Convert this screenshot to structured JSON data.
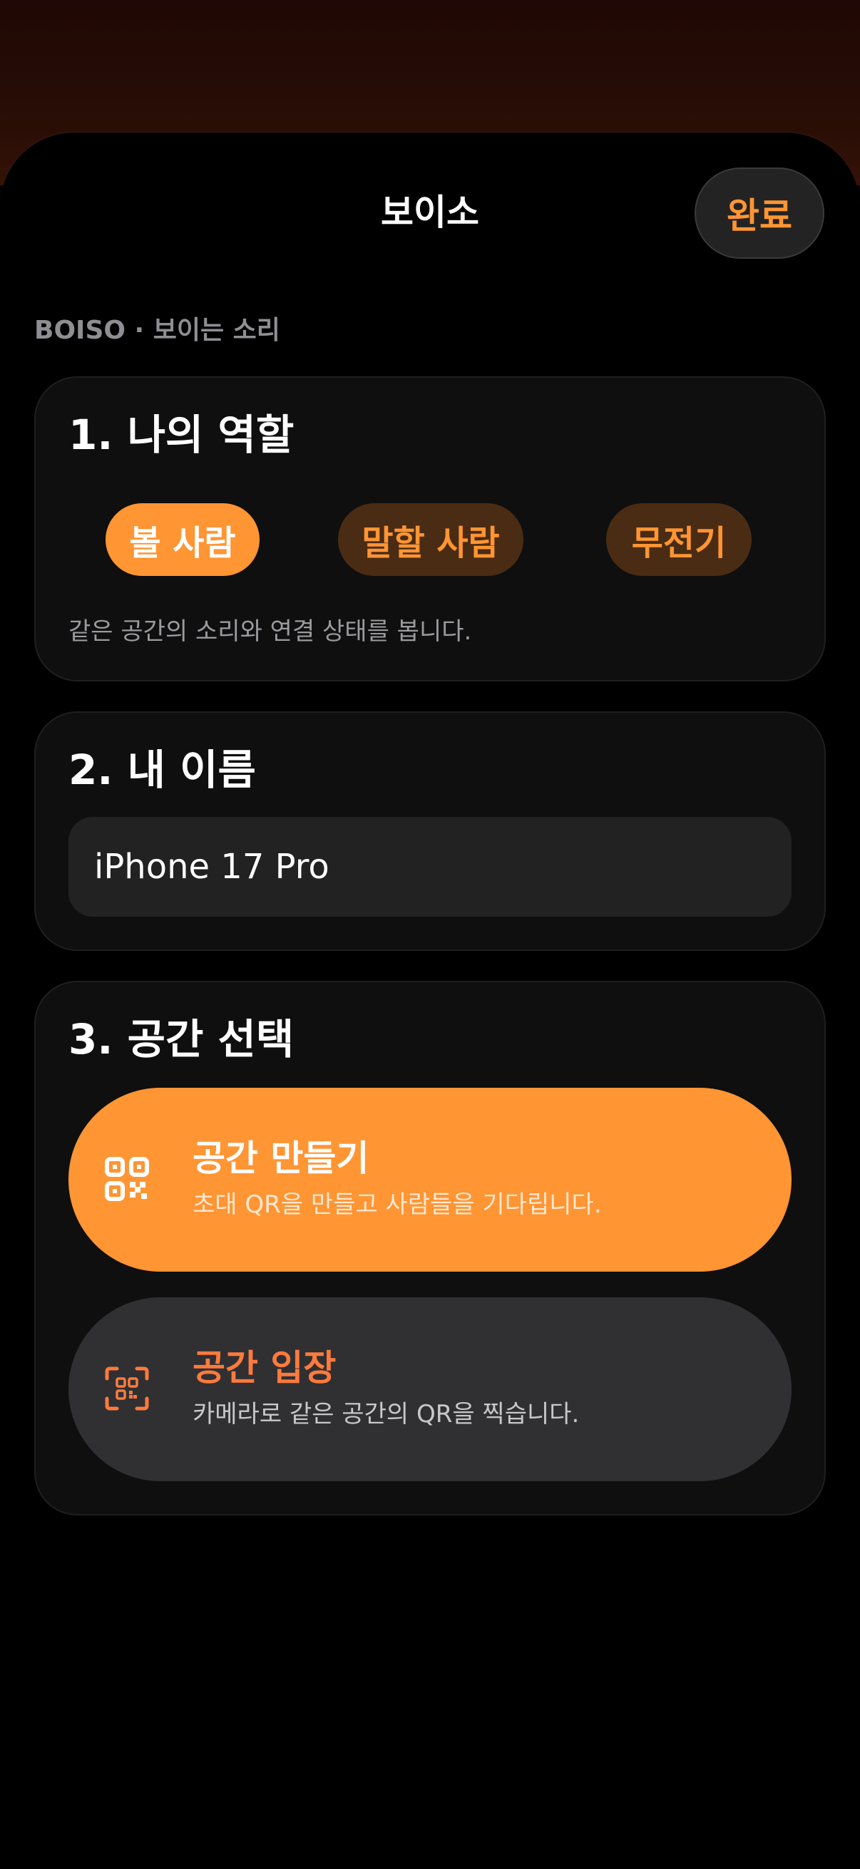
{
  "sheet": {
    "title": "보이소",
    "done_label": "완료"
  },
  "app": {
    "subtitle": "BOISO · 보이는 소리"
  },
  "role": {
    "heading": "1. 나의 역할",
    "options": [
      {
        "label": "볼 사람",
        "selected": true
      },
      {
        "label": "말할 사람",
        "selected": false
      },
      {
        "label": "무전기",
        "selected": false
      }
    ],
    "description": "같은 공간의 소리와 연결 상태를 봅니다."
  },
  "name": {
    "heading": "2. 내 이름",
    "value": "iPhone 17 Pro"
  },
  "space": {
    "heading": "3. 공간 선택",
    "create": {
      "title": "공간 만들기",
      "description": "초대 QR을 만들고 사람들을 기다립니다.",
      "icon": "qr-code-icon"
    },
    "join": {
      "title": "공간 입장",
      "description": "카메라로 같은 공간의 QR을 찍습니다.",
      "icon": "qr-scan-icon"
    }
  },
  "colors": {
    "accent": "#ff9533",
    "accent_dim": "#4a2c14",
    "join_title": "#ff7a3d",
    "card_bg": "#0f0f0f",
    "input_bg": "#222222"
  }
}
